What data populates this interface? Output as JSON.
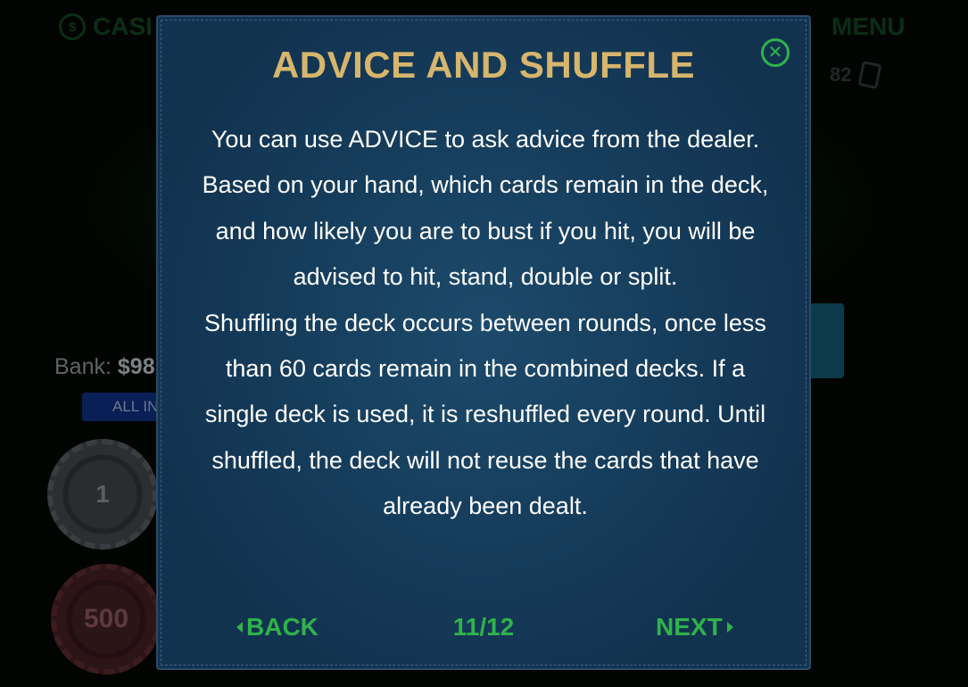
{
  "background": {
    "top_left_label": "CASI",
    "coin_label": "$",
    "menu_label": "MENU",
    "cards_remaining": "82",
    "bank_label": "Bank:",
    "bank_value": "$98",
    "all_in_label": "ALL IN",
    "chips": [
      "1",
      "500"
    ]
  },
  "modal": {
    "title": "ADVICE AND SHUFFLE",
    "close_icon": "close-circle-icon",
    "paragraphs": [
      "You can use ADVICE to ask advice from the dealer. Based on your hand, which cards remain in the deck, and how likely you are to bust if you hit, you will be advised to hit, stand, double or split.",
      "Shuffling the deck occurs between rounds, once less than 60 cards remain in the combined decks. If a single deck is used, it is reshuffled every round. Until shuffled, the deck will not reuse the cards that have already been dealt."
    ],
    "back_label": "BACK",
    "next_label": "NEXT",
    "page_counter": "11/12"
  },
  "colors": {
    "title_gold": "#d6b56c",
    "accent_green": "#2fb34a",
    "modal_bg": "#163d5c",
    "body_text": "#ffffff"
  }
}
